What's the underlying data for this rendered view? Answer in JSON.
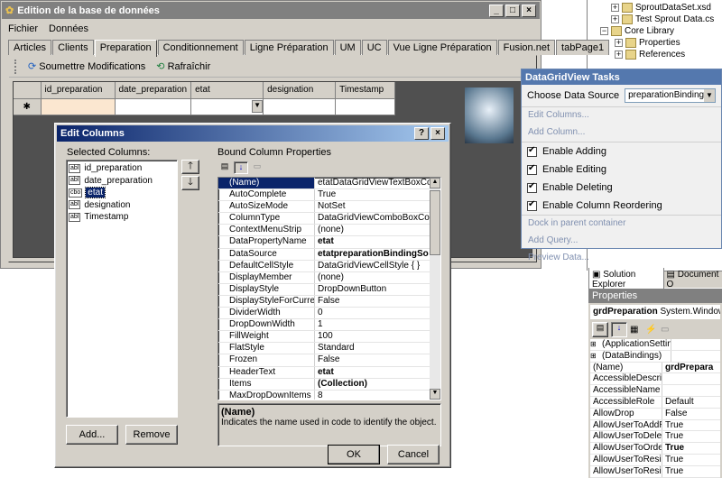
{
  "main_window": {
    "title": "Edition de la base de données",
    "menu": [
      "Fichier",
      "Données"
    ],
    "tabs": [
      "Articles",
      "Clients",
      "Preparation",
      "Conditionnement",
      "Ligne Préparation",
      "UM",
      "UC",
      "Vue Ligne Préparation",
      "Fusion.net",
      "tabPage1"
    ],
    "toolbar": {
      "submit": "Soumettre Modifications",
      "refresh": "Rafraîchir"
    },
    "grid": {
      "columns": [
        "id_preparation",
        "date_preparation",
        "etat",
        "designation",
        "Timestamp"
      ],
      "row_marker": "✱"
    }
  },
  "solution_explorer": {
    "items": [
      "SproutDataSet.xsd",
      "Test Sprout Data.cs",
      "Core Library",
      "Properties",
      "References"
    ],
    "tab1": "Solution Explorer",
    "tab2": "Document O"
  },
  "properties_panel": {
    "title": "Properties",
    "object_name": "grdPreparation",
    "object_type": "System.Windows.F",
    "rows": [
      {
        "n": "(ApplicationSettings",
        "v": ""
      },
      {
        "n": "(DataBindings)",
        "v": ""
      },
      {
        "n": "(Name)",
        "v": "grdPrepara"
      },
      {
        "n": "AccessibleDescripti",
        "v": ""
      },
      {
        "n": "AccessibleName",
        "v": ""
      },
      {
        "n": "AccessibleRole",
        "v": "Default"
      },
      {
        "n": "AllowDrop",
        "v": "False"
      },
      {
        "n": "AllowUserToAddRo",
        "v": "True"
      },
      {
        "n": "AllowUserToDeleteR",
        "v": "True"
      },
      {
        "n": "AllowUserToOrderCo",
        "v": "True"
      },
      {
        "n": "AllowUserToResizeC",
        "v": "True"
      },
      {
        "n": "AllowUserToResizeR",
        "v": "True"
      }
    ]
  },
  "tasks": {
    "title": "DataGridView Tasks",
    "choose_label": "Choose Data Source",
    "source": "preparationBindingSource",
    "links": [
      "Edit Columns...",
      "Add Column..."
    ],
    "checks": [
      "Enable Adding",
      "Enable Editing",
      "Enable Deleting",
      "Enable Column Reordering"
    ],
    "link2": [
      "Dock in parent container",
      "Add Query...",
      "Preview Data..."
    ]
  },
  "edit_columns": {
    "title": "Edit Columns",
    "selected_label": "Selected Columns:",
    "bound_label": "Bound Column Properties",
    "columns": [
      {
        "icon": "abl",
        "name": "id_preparation"
      },
      {
        "icon": "abl",
        "name": "date_preparation"
      },
      {
        "icon": "cbo",
        "name": "etat"
      },
      {
        "icon": "abl",
        "name": "designation"
      },
      {
        "icon": "abl",
        "name": "Timestamp"
      }
    ],
    "props": [
      {
        "n": "(Name)",
        "v": "etatDataGridViewTextBoxColu",
        "b": false
      },
      {
        "n": "AutoComplete",
        "v": "True",
        "b": false
      },
      {
        "n": "AutoSizeMode",
        "v": "NotSet",
        "b": false
      },
      {
        "n": "ColumnType",
        "v": "DataGridViewComboBoxColum",
        "b": false
      },
      {
        "n": "ContextMenuStrip",
        "v": "(none)",
        "b": false
      },
      {
        "n": "DataPropertyName",
        "v": "etat",
        "b": true
      },
      {
        "n": "DataSource",
        "v": "etatpreparationBindingSo",
        "b": true
      },
      {
        "n": "DefaultCellStyle",
        "v": "DataGridViewCellStyle { }",
        "b": false
      },
      {
        "n": "DisplayMember",
        "v": "(none)",
        "b": false
      },
      {
        "n": "DisplayStyle",
        "v": "DropDownButton",
        "b": false
      },
      {
        "n": "DisplayStyleForCurrentCellO",
        "v": "False",
        "b": false
      },
      {
        "n": "DividerWidth",
        "v": "0",
        "b": false
      },
      {
        "n": "DropDownWidth",
        "v": "1",
        "b": false
      },
      {
        "n": "FillWeight",
        "v": "100",
        "b": false
      },
      {
        "n": "FlatStyle",
        "v": "Standard",
        "b": false
      },
      {
        "n": "Frozen",
        "v": "False",
        "b": false
      },
      {
        "n": "HeaderText",
        "v": "etat",
        "b": true
      },
      {
        "n": "Items",
        "v": "(Collection)",
        "b": true
      },
      {
        "n": "MaxDropDownItems",
        "v": "8",
        "b": false
      }
    ],
    "desc_title": "(Name)",
    "desc_text": "Indicates the name used in code to identify the object.",
    "add": "Add...",
    "remove": "Remove",
    "ok": "OK",
    "cancel": "Cancel"
  }
}
